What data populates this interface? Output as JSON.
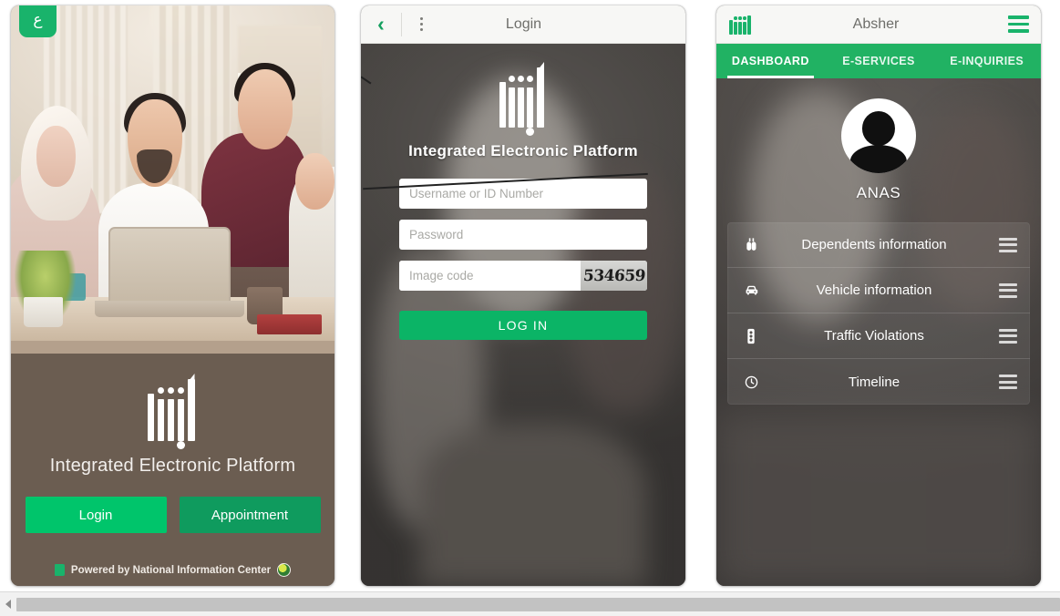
{
  "splash": {
    "lang_badge": "ع",
    "title": "Integrated Electronic Platform",
    "login_label": "Login",
    "appointment_label": "Appointment",
    "powered_text": "Powered by National Information Center",
    "hero_alt": "family-photo",
    "colors": {
      "login_green": "#00c56b",
      "appointment_green": "#0f9b5e",
      "panel_brown": "#6b5d51",
      "badge_green": "#19b36b"
    }
  },
  "login": {
    "topbar": {
      "title": "Login",
      "back_icon": "chevron-left-icon",
      "menu_icon": "kebab-menu-icon"
    },
    "title": "Integrated Electronic Platform",
    "username_placeholder": "Username or ID Number",
    "username_value": "",
    "password_placeholder": "Password",
    "password_value": "",
    "imagecode_placeholder": "Image code",
    "imagecode_value": "",
    "captcha_text": "534659",
    "refresh_icon": "refresh-icon",
    "submit_label": "LOG IN",
    "colors": {
      "submit_green": "#0bb466",
      "back_green": "#15a05f"
    }
  },
  "dashboard": {
    "topbar": {
      "title": "Absher",
      "brand_icon": "absher-logo-icon",
      "menu_icon": "hamburger-icon"
    },
    "tabs": [
      {
        "label": "DASHBOARD",
        "active": true
      },
      {
        "label": "E-SERVICES",
        "active": false
      },
      {
        "label": "E-INQUIRIES",
        "active": false
      }
    ],
    "user_name": "ANAS",
    "avatar_icon": "person-avatar-icon",
    "items": [
      {
        "label": "Dependents information",
        "icon": "binoculars-icon",
        "handle": "drag-handle-icon"
      },
      {
        "label": "Vehicle information",
        "icon": "car-icon",
        "handle": "drag-handle-icon"
      },
      {
        "label": "Traffic Violations",
        "icon": "traffic-light-icon",
        "handle": "drag-handle-icon"
      },
      {
        "label": "Timeline",
        "icon": "clock-icon",
        "handle": "drag-handle-icon"
      }
    ],
    "colors": {
      "tabbar_green": "#21b263",
      "brand_green": "#19b36b"
    }
  },
  "scrollbar": {
    "left_arrow_icon": "arrow-left-icon"
  }
}
